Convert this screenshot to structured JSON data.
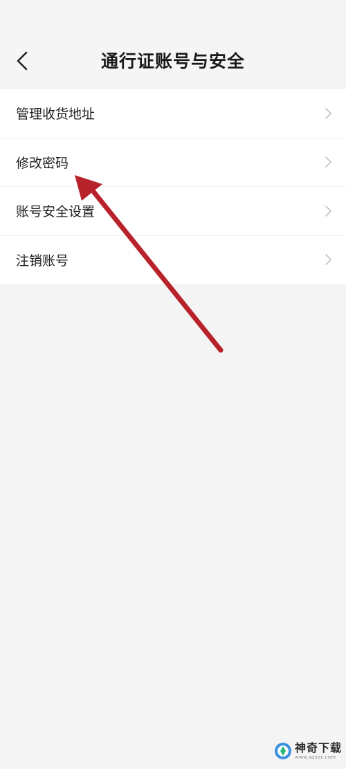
{
  "header": {
    "title": "通行证账号与安全",
    "back_icon": "chevron-left-icon"
  },
  "menu": {
    "items": [
      {
        "label": "管理收货地址",
        "icon": "chevron-right-icon"
      },
      {
        "label": "修改密码",
        "icon": "chevron-right-icon"
      },
      {
        "label": "账号安全设置",
        "icon": "chevron-right-icon"
      },
      {
        "label": "注销账号",
        "icon": "chevron-right-icon"
      }
    ]
  },
  "annotation": {
    "arrow_color": "#b8222a",
    "points_to": "修改密码"
  },
  "watermark": {
    "name": "神奇下载",
    "url": "www.sqxzz.com"
  },
  "colors": {
    "background": "#f4f4f4",
    "card": "#ffffff",
    "text": "#1f1f1f",
    "chevron": "#c2c2c2"
  }
}
